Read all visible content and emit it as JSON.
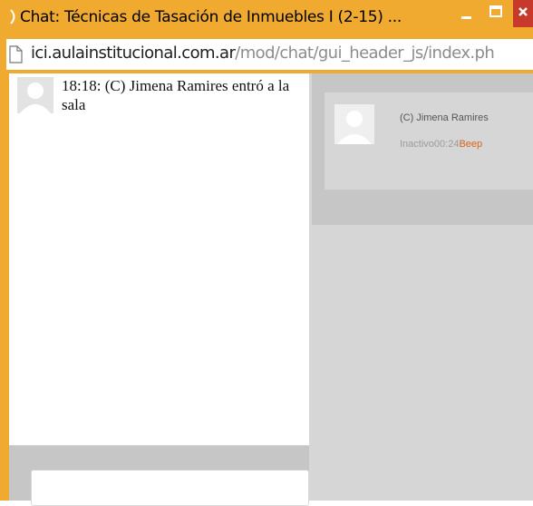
{
  "window": {
    "title": "Chat: Técnicas de Tasación de Inmuebles I (2-15) ...",
    "accent_color": "#efaa2f",
    "close_color": "#c7392b"
  },
  "address_bar": {
    "host": "ici.aulainstitucional.com.ar",
    "path": "/mod/chat/gui_header_js/index.ph"
  },
  "messages": [
    {
      "avatar_icon": "user-avatar-icon",
      "text": "18:18: (C) Jimena Ramires entró a la sala"
    }
  ],
  "users": [
    {
      "name": "(C) Jimena Ramires",
      "status": "Inactivo00:24",
      "beep_label": "Beep",
      "avatar_icon": "user-avatar-icon"
    }
  ]
}
